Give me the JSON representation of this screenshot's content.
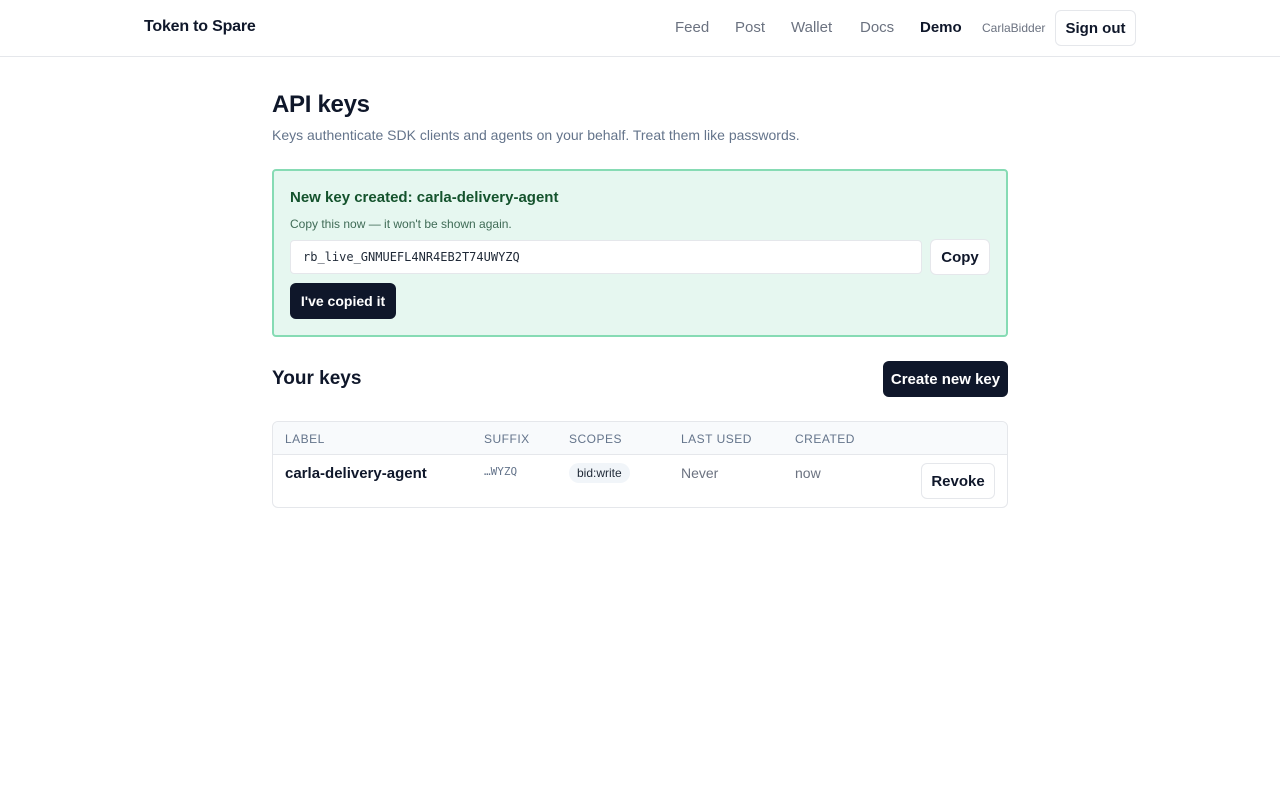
{
  "header": {
    "brand": "Token to Spare",
    "nav": [
      "Feed",
      "Post",
      "Wallet",
      "Docs",
      "Demo"
    ],
    "active_nav": "Demo",
    "username": "CarlaBidder",
    "signout_label": "Sign out"
  },
  "page": {
    "title": "API keys",
    "subtitle": "Keys authenticate SDK clients and agents on your behalf. Treat them like passwords."
  },
  "new_key": {
    "title": "New key created: carla-delivery-agent",
    "hint": "Copy this now — it won't be shown again.",
    "value": "rb_live_GNMUEFL4NR4EB2T74UWYZQ",
    "copy_label": "Copy",
    "copied_label": "I've copied it"
  },
  "keys": {
    "section_title": "Your keys",
    "create_label": "Create new key",
    "columns": [
      "LABEL",
      "SUFFIX",
      "SCOPES",
      "LAST USED",
      "CREATED"
    ],
    "rows": [
      {
        "label": "carla-delivery-agent",
        "suffix": "…WYZQ",
        "scope": "bid:write",
        "last_used": "Never",
        "created": "now",
        "revoke_label": "Revoke"
      }
    ]
  },
  "colors": {
    "primary": "#0f172a",
    "notice_bg": "#e6f7f0",
    "notice_border": "#86dbb4",
    "muted_text": "#64748b"
  }
}
